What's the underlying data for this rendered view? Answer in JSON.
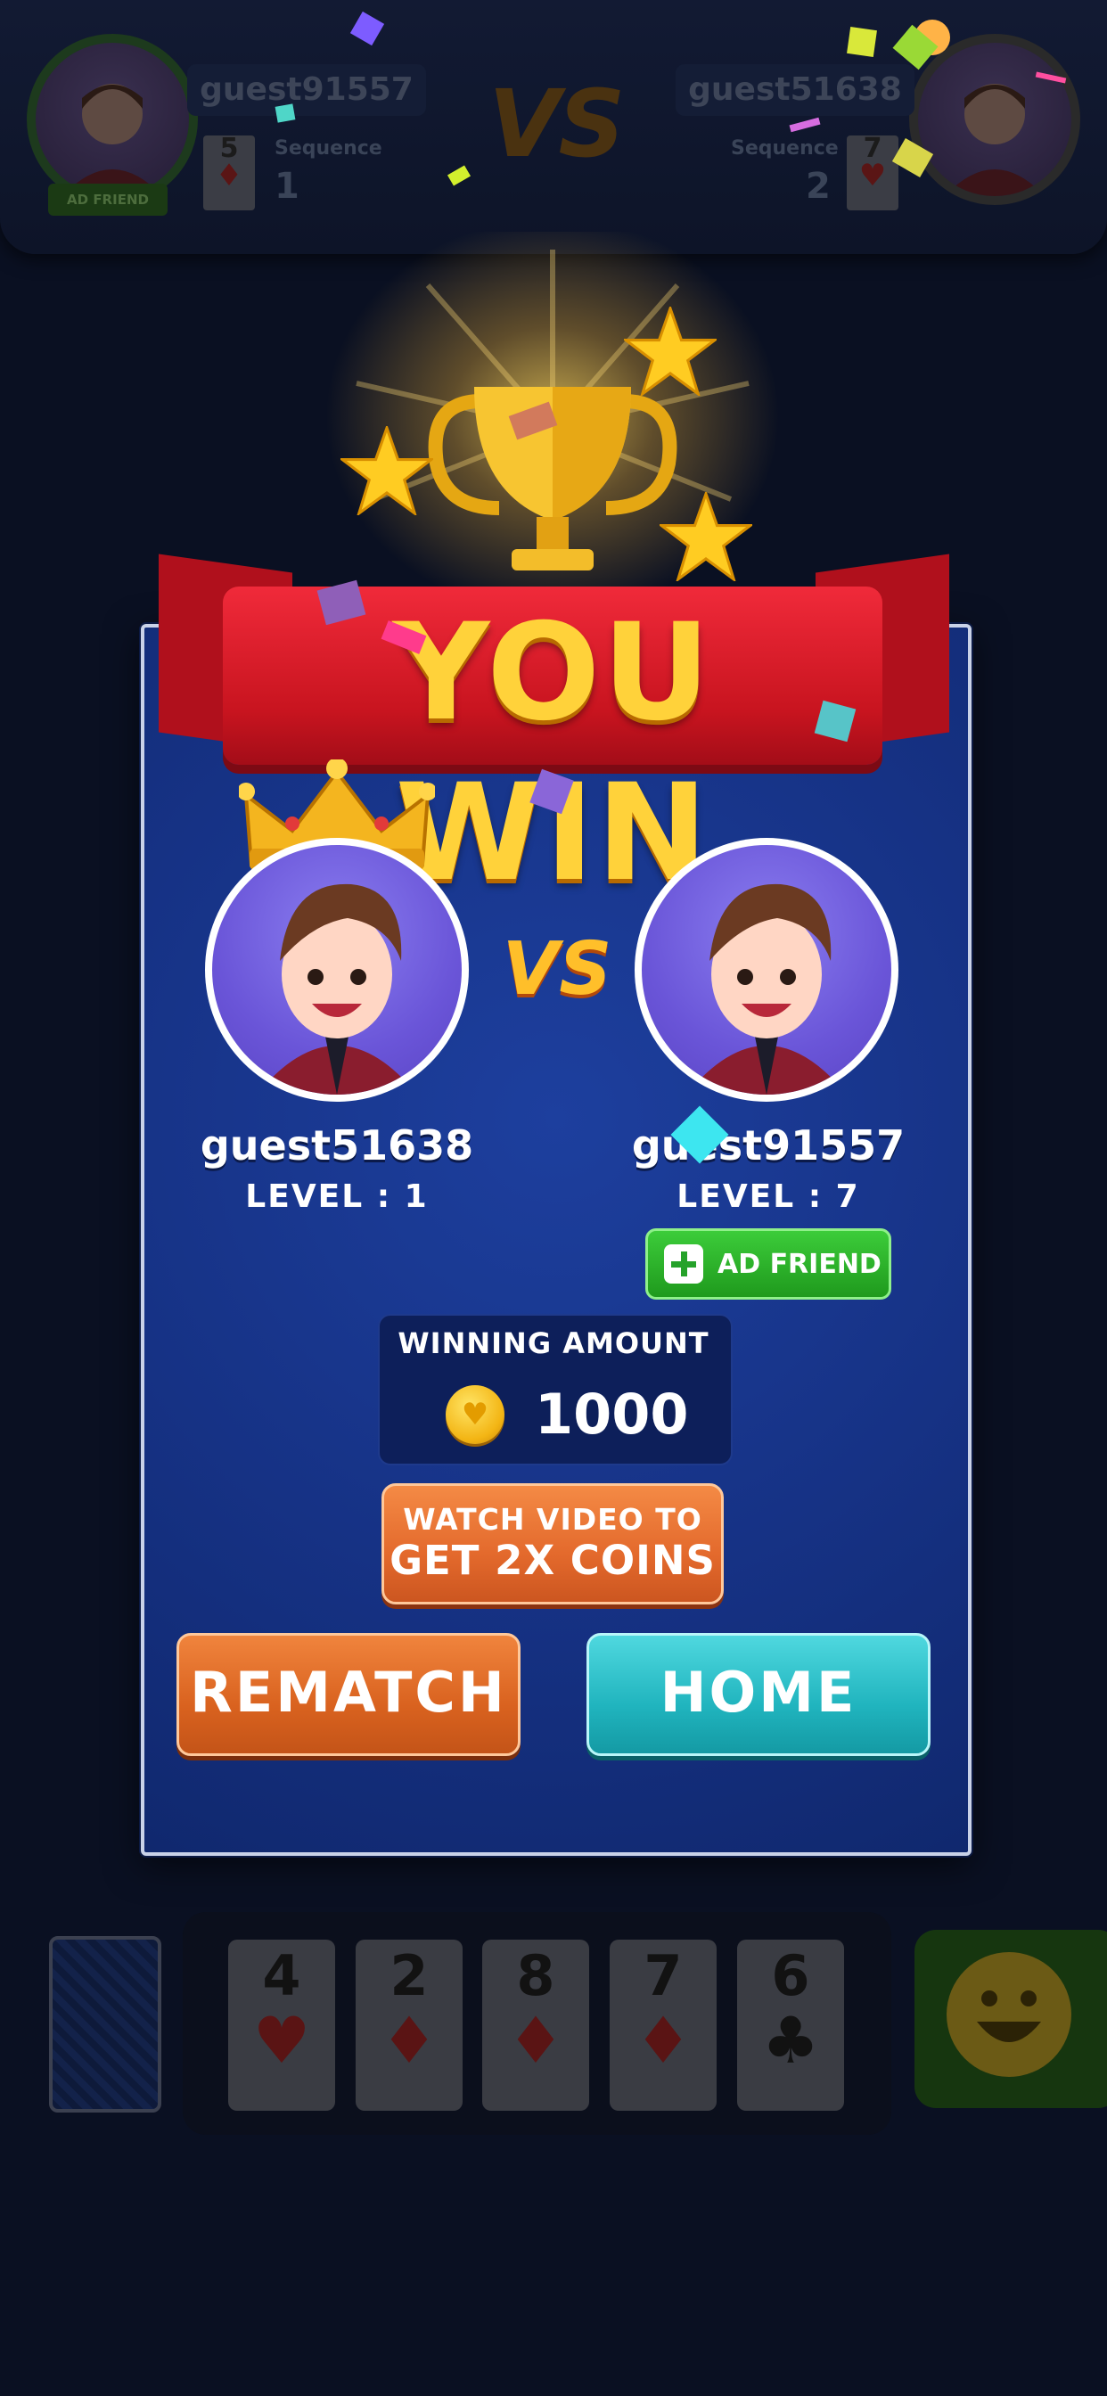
{
  "background": {
    "player_left": {
      "name": "guest91557",
      "sequence_label": "Sequence",
      "sequence_value": "1",
      "card_rank": "5",
      "card_suit": "♦",
      "ad_friend": "AD FRIEND"
    },
    "player_right": {
      "name": "guest51638",
      "sequence_label": "Sequence",
      "sequence_value": "2",
      "card_rank": "7",
      "card_suit": "♥"
    },
    "vs": "VS",
    "hand": [
      {
        "rank": "4",
        "suit": "♥",
        "suit_color": "red"
      },
      {
        "rank": "2",
        "suit": "♦",
        "suit_color": "red"
      },
      {
        "rank": "8",
        "suit": "♦",
        "suit_color": "red"
      },
      {
        "rank": "7",
        "suit": "♦",
        "suit_color": "red"
      },
      {
        "rank": "6",
        "suit": "♣",
        "suit_color": "black"
      }
    ]
  },
  "dialog": {
    "title": "YOU WIN",
    "vs": "VS",
    "winner": {
      "name": "guest51638",
      "level": "LEVEL : 1"
    },
    "opponent": {
      "name": "guest91557",
      "level": "LEVEL : 7",
      "ad_friend": "AD FRIEND"
    },
    "winning_label": "WINNING AMOUNT",
    "winning_amount": "1000",
    "watch_line1": "WATCH VIDEO TO",
    "watch_line2": "GET 2X COINS",
    "rematch": "REMATCH",
    "home": "HOME"
  },
  "colors": {
    "ribbon": "#d41a26",
    "panel": "#163285",
    "gold": "#ffd23a",
    "rematch": "#e3692c",
    "home": "#20b4be",
    "ad_friend": "#2bb62a"
  }
}
